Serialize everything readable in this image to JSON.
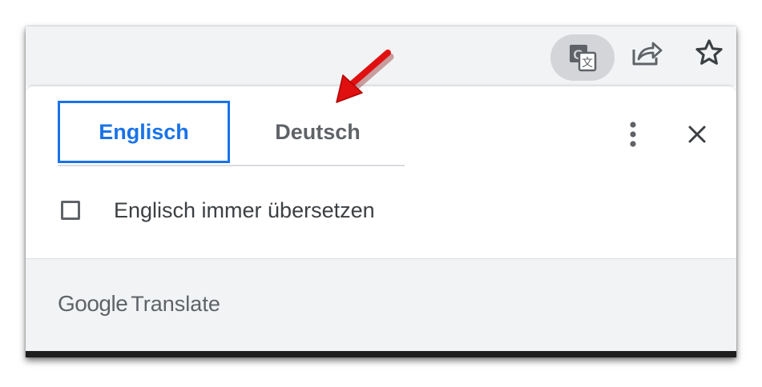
{
  "toolbar": {
    "buttons": [
      {
        "name": "translate-icon"
      },
      {
        "name": "share-icon"
      },
      {
        "name": "star-icon"
      }
    ]
  },
  "popup": {
    "tabs": [
      {
        "label": "Englisch",
        "active": true
      },
      {
        "label": "Deutsch",
        "active": false
      }
    ],
    "option": {
      "label": "Englisch immer übersetzen",
      "checked": false
    },
    "footer": {
      "brand_google": "Google",
      "brand_translate": "Translate"
    }
  },
  "colors": {
    "accent": "#1a73e8",
    "annotation_arrow": "#e01010",
    "toolbar_bg": "#f1f3f4"
  }
}
